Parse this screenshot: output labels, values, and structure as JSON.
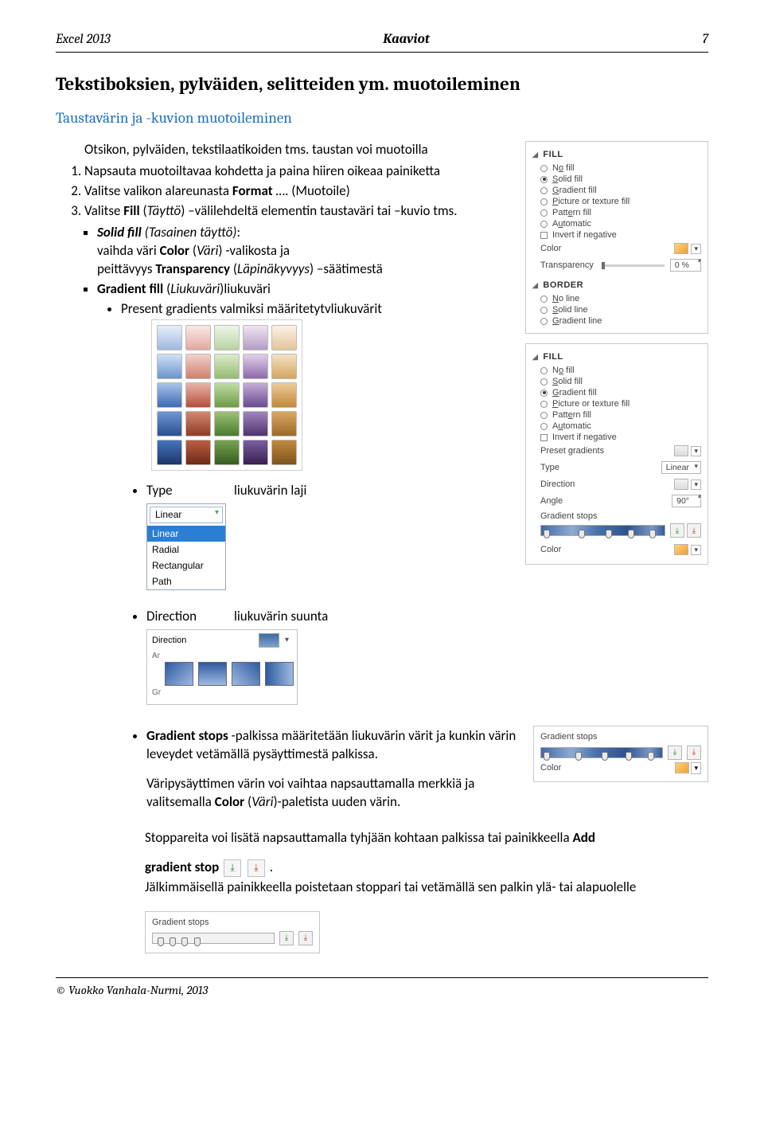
{
  "header": {
    "left": "Excel 2013",
    "center": "Kaaviot",
    "right": "7"
  },
  "h1": "Tekstiboksien, pylväiden, selitteiden ym. muotoileminen",
  "h2": "Taustavärin ja -kuvion muotoileminen",
  "intro": "Otsikon, pylväiden, tekstilaatikoiden tms. taustan voi muotoilla",
  "steps": {
    "s1": "Napsauta muotoiltavaa kohdetta ja paina hiiren oikeaa painiketta",
    "s2a": "Valitse valikon alareunasta ",
    "s2b": "Format",
    "s2c": " …. (Muotoile)",
    "s3a": "Valitse ",
    "s3b": "Fill",
    "s3c": " (",
    "s3d": "Täyttö",
    "s3e": ") –välilehdeltä elementin taustaväri tai –kuvio tms."
  },
  "solid": {
    "title1": "Solid fill ",
    "title2": "(Tasainen täyttö)",
    "l1a": "vaihda väri ",
    "l1b": "Color",
    "l1c": " (",
    "l1d": "Väri",
    "l1e": ") -valikosta ja",
    "l2a": "peittävyys ",
    "l2b": "Transparency",
    "l2c": " (",
    "l2d": "Läpinäkyvyys",
    "l2e": ") –säätimestä"
  },
  "gradient": {
    "title1": "Gradient fill",
    "title2": "  (",
    "title3": "Liukuväri",
    "title4": ")liukuväri",
    "preset": "Present gradients valmiksi määritetytvliukuvärit"
  },
  "typeRow": {
    "label": "Type",
    "desc": "liukuvärin laji"
  },
  "dirRow": {
    "label": "Direction",
    "desc": "liukuvärin suunta"
  },
  "menu": {
    "top": "Linear",
    "items": [
      "Linear",
      "Radial",
      "Rectangular",
      "Path"
    ],
    "selectedIndex": 0
  },
  "dirPanel": {
    "label": "Direction",
    "ar": "Ar",
    "gr": "Gr"
  },
  "stopsBlock": {
    "p1a": "Gradient stops",
    "p1b": " -palkissa määritetään liukuvärin värit ja kunkin värin leveydet vetämällä pysäyttimestä palkissa.",
    "p2a": "Väripysäyttimen värin voi vaihtaa napsauttamalla merkkiä ja valitsemalla ",
    "p2b": "Color",
    "p2c": " (",
    "p2d": "Väri",
    "p2e": ")-paletista uuden värin.",
    "p3a": "Stoppareita voi lisätä napsauttamalla tyhjään kohtaan palkissa tai painikkeella ",
    "p3b": "Add",
    "p4a": "gradient stop",
    "p4b": ".",
    "p5": "Jälkimmäisellä painikkeella poistetaan stoppari tai vetämällä sen palkin ylä- tai alapuolelle"
  },
  "panel": {
    "fill": "FILL",
    "border": "BORDER",
    "noFill": "No fill",
    "solidFill": "Solid fill",
    "gradientFill": "Gradient fill",
    "pictureFill": "Picture or texture fill",
    "patternFill": "Pattern fill",
    "automatic": "Automatic",
    "invert": "Invert if negative",
    "color": "Color",
    "transparency": "Transparency",
    "noLine": "No line",
    "solidLine": "Solid line",
    "gradientLine": "Gradient line",
    "presetGradients": "Preset gradients",
    "type": "Type",
    "typeVal": "Linear",
    "direction": "Direction",
    "angle": "Angle",
    "angleVal": "90°",
    "gradientStops": "Gradient stops",
    "zeroPct": "0 %"
  },
  "gsMini": {
    "title": "Gradient stops",
    "color": "Color"
  },
  "footer": "© Vuokko Vanhala-Nurmi, 2013"
}
